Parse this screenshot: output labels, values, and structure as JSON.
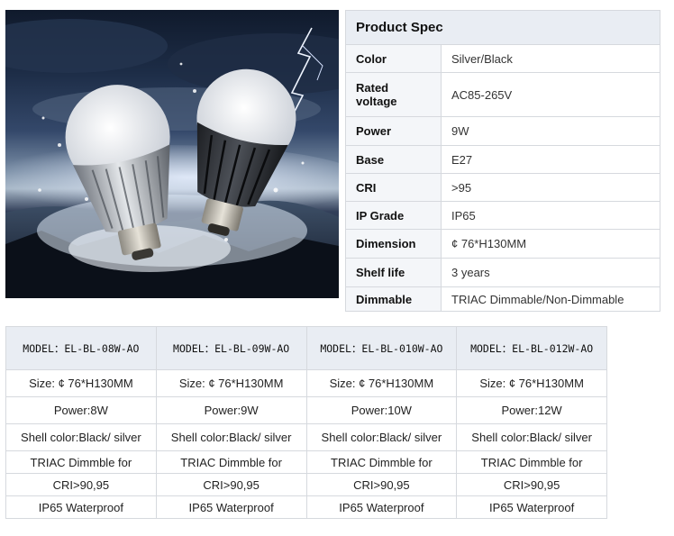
{
  "spec": {
    "title": "Product Spec",
    "rows": [
      {
        "label": "Color",
        "value": "Silver/Black"
      },
      {
        "label": "Rated voltage",
        "value": "AC85-265V"
      },
      {
        "label": "Power",
        "value": "9W"
      },
      {
        "label": "Base",
        "value": "E27"
      },
      {
        "label": "CRI",
        "value": ">95"
      },
      {
        "label": "IP Grade",
        "value": "IP65"
      },
      {
        "label": "Dimension",
        "value": "¢ 76*H130MM"
      },
      {
        "label": "Shelf life",
        "value": "3 years"
      },
      {
        "label": "Dimmable",
        "value": "TRIAC Dimmable/Non-Dimmable"
      }
    ]
  },
  "models": {
    "headers": [
      "MODEL：EL-BL-08W-AO",
      "MODEL：EL-BL-09W-AO",
      "MODEL：EL-BL-010W-AO",
      "MODEL：EL-BL-012W-AO"
    ],
    "rows": [
      [
        "Size:  ¢ 76*H130MM",
        "Size:  ¢ 76*H130MM",
        "Size:  ¢ 76*H130MM",
        "Size:  ¢ 76*H130MM"
      ],
      [
        "Power:8W",
        "Power:9W",
        "Power:10W",
        "Power:12W"
      ],
      [
        "Shell color:Black/ silver",
        "Shell color:Black/ silver",
        "Shell color:Black/ silver",
        "Shell color:Black/ silver"
      ],
      [
        "TRIAC Dimmble for",
        "TRIAC Dimmble for",
        "TRIAC Dimmble for",
        "TRIAC Dimmble for"
      ],
      [
        "CRI>90,95",
        "CRI>90,95",
        "CRI>90,95",
        "CRI>90,95"
      ],
      [
        "IP65 Waterproof",
        "IP65 Waterproof",
        "IP65 Waterproof",
        "IP65 Waterproof"
      ]
    ]
  }
}
